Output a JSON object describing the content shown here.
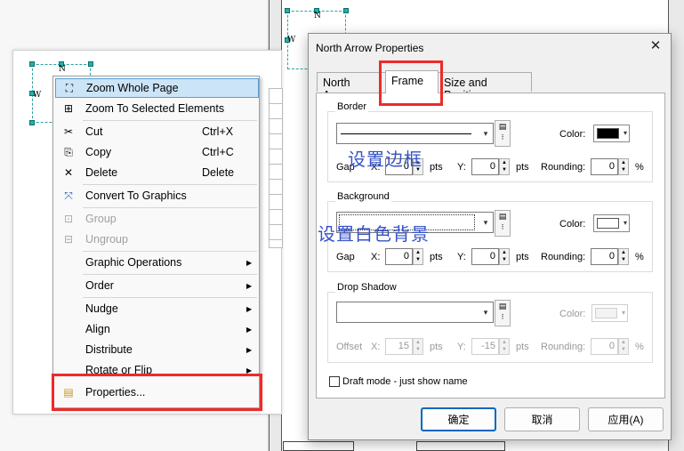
{
  "map": {
    "north_arrow_letters": {
      "n": "N",
      "w": "W"
    }
  },
  "context_menu": {
    "items": [
      {
        "icon": "zoom-whole-page-icon",
        "label": "Zoom Whole Page",
        "shortcut": "",
        "submenu": false,
        "disabled": false,
        "highlighted": true
      },
      {
        "icon": "zoom-selected-icon",
        "label": "Zoom To Selected Elements",
        "shortcut": "",
        "submenu": false,
        "disabled": false
      },
      {
        "icon": "cut-icon",
        "label": "Cut",
        "shortcut": "Ctrl+X",
        "submenu": false,
        "disabled": false
      },
      {
        "icon": "copy-icon",
        "label": "Copy",
        "shortcut": "Ctrl+C",
        "submenu": false,
        "disabled": false
      },
      {
        "icon": "delete-icon",
        "label": "Delete",
        "shortcut": "Delete",
        "submenu": false,
        "disabled": false
      },
      {
        "icon": "convert-graphics-icon",
        "label": "Convert To Graphics",
        "shortcut": "",
        "submenu": false,
        "disabled": false
      },
      {
        "icon": "group-icon",
        "label": "Group",
        "shortcut": "",
        "submenu": false,
        "disabled": true
      },
      {
        "icon": "ungroup-icon",
        "label": "Ungroup",
        "shortcut": "",
        "submenu": false,
        "disabled": true
      },
      {
        "icon": "",
        "label": "Graphic Operations",
        "shortcut": "",
        "submenu": true,
        "disabled": false
      },
      {
        "icon": "",
        "label": "Order",
        "shortcut": "",
        "submenu": true,
        "disabled": false
      },
      {
        "icon": "",
        "label": "Nudge",
        "shortcut": "",
        "submenu": true,
        "disabled": false
      },
      {
        "icon": "",
        "label": "Align",
        "shortcut": "",
        "submenu": true,
        "disabled": false
      },
      {
        "icon": "",
        "label": "Distribute",
        "shortcut": "",
        "submenu": true,
        "disabled": false
      },
      {
        "icon": "",
        "label": "Rotate or Flip",
        "shortcut": "",
        "submenu": true,
        "disabled": false
      },
      {
        "icon": "properties-icon",
        "label": "Properties...",
        "shortcut": "",
        "submenu": false,
        "disabled": false
      }
    ]
  },
  "dialog": {
    "title": "North Arrow Properties",
    "tabs": [
      {
        "label": "North Arrow",
        "active": false
      },
      {
        "label": "Frame",
        "active": true
      },
      {
        "label": "Size and Position",
        "active": false
      }
    ],
    "border": {
      "title": "Border",
      "color_label": "Color:",
      "color": "#000000",
      "gap_label": "Gap",
      "x_label": "X:",
      "x_value": "0",
      "y_label": "Y:",
      "y_value": "0",
      "unit": "pts",
      "rounding_label": "Rounding:",
      "rounding_value": "0",
      "percent": "%"
    },
    "background": {
      "title": "Background",
      "color_label": "Color:",
      "color": "#ffffff",
      "gap_label": "Gap",
      "x_label": "X:",
      "x_value": "0",
      "y_label": "Y:",
      "y_value": "0",
      "unit": "pts",
      "rounding_label": "Rounding:",
      "rounding_value": "0",
      "percent": "%"
    },
    "shadow": {
      "title": "Drop Shadow",
      "color_label": "Color:",
      "offset_label": "Offset",
      "x_label": "X:",
      "x_value": "15",
      "y_label": "Y:",
      "y_value": "-15",
      "unit": "pts",
      "rounding_label": "Rounding:",
      "rounding_value": "0",
      "percent": "%"
    },
    "draft_mode": {
      "label": "Draft mode - just show name",
      "checked": false
    },
    "buttons": {
      "ok": "确定",
      "cancel": "取消",
      "apply": "应用(A)"
    }
  },
  "annotations": {
    "set_border": "设置边框",
    "set_white_bg": "设置白色背景"
  },
  "colors": {
    "highlight_red": "#ee2a2a",
    "annotation_blue": "#3552c8",
    "menu_highlight": "#cce4f7",
    "default_button_border": "#0067c0"
  }
}
